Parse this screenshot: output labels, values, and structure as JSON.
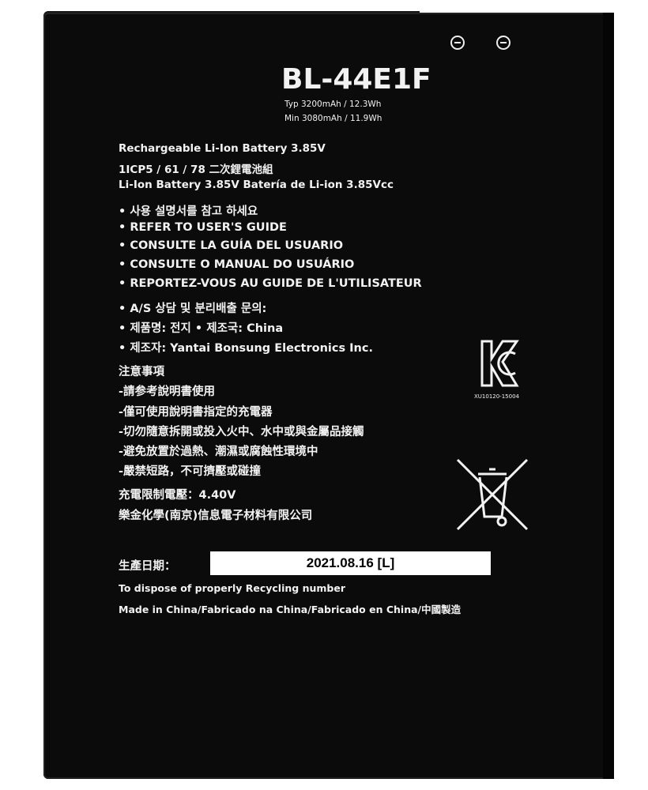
{
  "model": "BL-44E1F",
  "specs": [
    "Typ 3200mAh / 12.3Wh",
    "Min 3080mAh / 11.9Wh"
  ],
  "lines": [
    "Rechargeable Li-Ion Battery 3.85V",
    "1ICP5 / 61 / 78  二次鋰電池組",
    "Li-Ion Battery 3.85V Batería de Li-ion 3.85Vcc",
    "• 사용 설명서를 참고 하세요",
    "• REFER TO USER'S GUIDE",
    "• CONSULTE LA GUÍA DEL USUARIO",
    "• CONSULTE O MANUAL DO USUÁRIO",
    "• REPORTEZ-VOUS AU GUIDE DE L'UTILISATEUR",
    "• A/S 상담 및 분리배출 문의:",
    "• 제품명: 전지      • 제조국: China",
    "• 제조자: Yantai Bonsung Electronics Inc.",
    "注意事項",
    "-請参考說明書使用",
    "-僅可使用說明書指定的充電器",
    "-切勿隨意拆開或投入火中、水中或與金屬品接觸",
    "-避免放置於過熱、潮濕或腐蝕性環境中",
    "-嚴禁短路，不可擠壓或碰撞",
    "充電限制電壓：4.40V",
    "樂金化學(南京)信息電子材料有限公司"
  ],
  "date_label": "生產日期：",
  "date_value": "2021.08.16 [L]",
  "footer": [
    "To dispose of properly Recycling number",
    "Made in China/Fabricado na China/Fabricado en China/中國製造"
  ],
  "kc_mark": "KC",
  "kc_code": "XU10120-15004",
  "icons": [
    "kc-certification-mark",
    "crossed-out-wheelie-bin-icon"
  ]
}
